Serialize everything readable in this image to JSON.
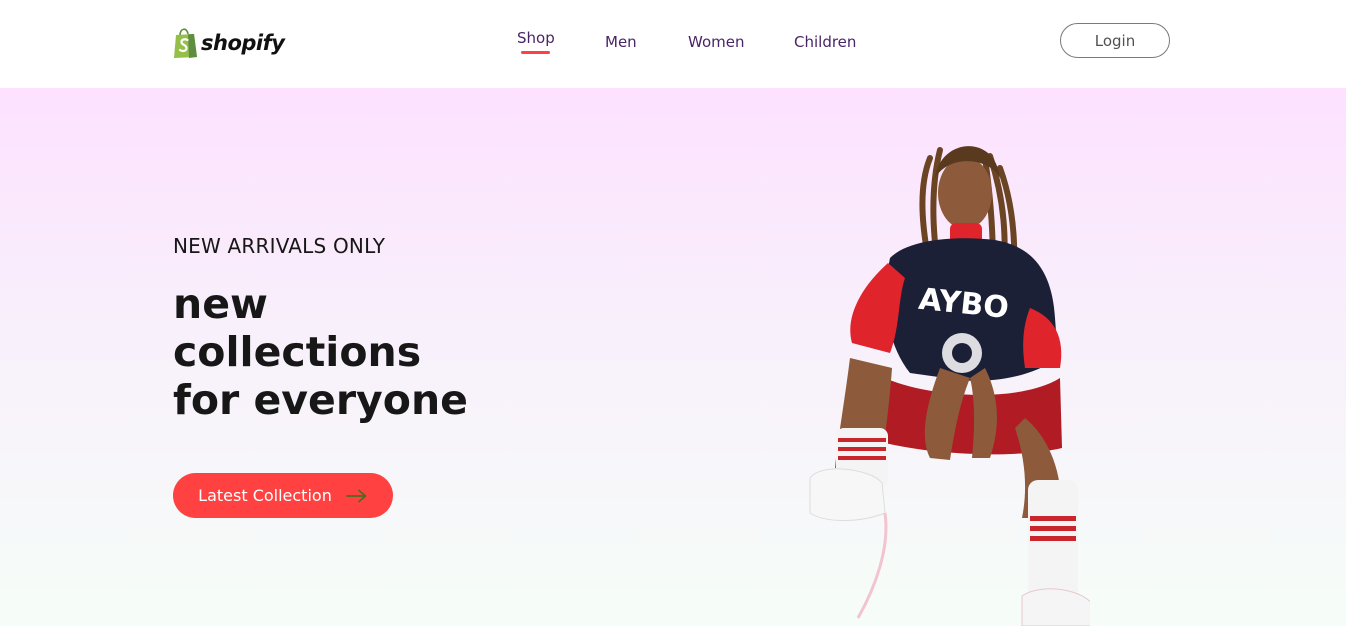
{
  "brand": {
    "name": "shopify",
    "logo_color": "#95bf47"
  },
  "nav": {
    "items": [
      {
        "label": "Shop",
        "active": true
      },
      {
        "label": "Men",
        "active": false
      },
      {
        "label": "Women",
        "active": false
      },
      {
        "label": "Children",
        "active": false
      }
    ],
    "login_label": "Login",
    "active_indicator_color": "#ff4141"
  },
  "hero": {
    "tagline": "NEW ARRIVALS ONLY",
    "title_lines": [
      "new",
      "collections",
      "for everyone"
    ],
    "cta_label": "Latest Collection",
    "cta_icon": "arrow-right-icon",
    "cta_color": "#ff4141",
    "image": "hero-model-image"
  }
}
